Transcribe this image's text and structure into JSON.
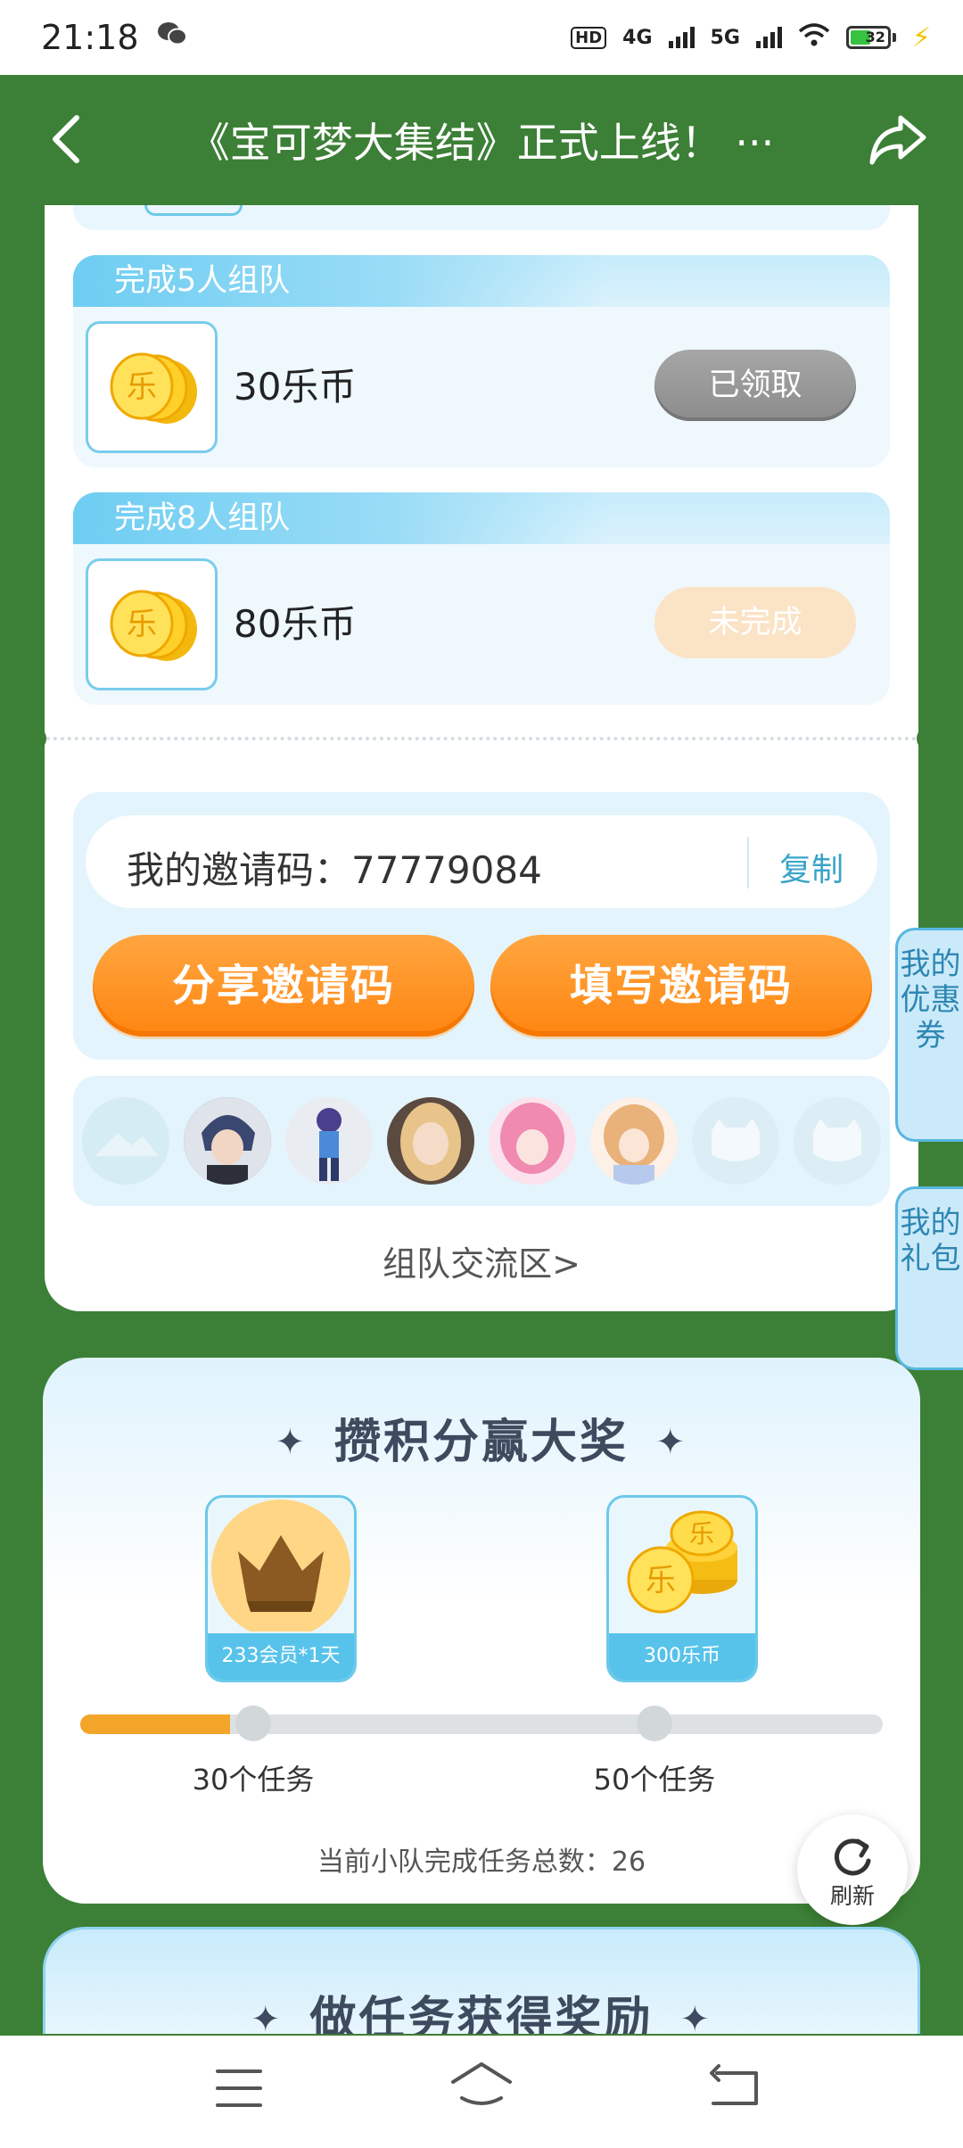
{
  "status_bar": {
    "time": "21:18",
    "network1": "4G",
    "network2": "5G",
    "battery": "32"
  },
  "header": {
    "title": "《宝可梦大集结》正式上线！ ···"
  },
  "tiers": [
    {
      "label": "完成5人组队",
      "amount": "30乐币",
      "button": "已领取"
    },
    {
      "label": "完成8人组队",
      "amount": "80乐币",
      "button": "未完成"
    }
  ],
  "invite": {
    "code_label": "我的邀请码：",
    "code": "77779084",
    "copy": "复制",
    "share_button": "分享邀请码",
    "fill_button": "填写邀请码"
  },
  "team_link": "组队交流区>",
  "side_tabs": {
    "coupons": "我的优惠券",
    "gifts": "我的礼包"
  },
  "prize_section": {
    "title": "攒积分赢大奖",
    "prizes": [
      {
        "tag": "233会员*1天",
        "milestone": "30个任务"
      },
      {
        "tag": "300乐币",
        "milestone": "50个任务"
      }
    ],
    "progress": 26,
    "summary_label": "当前小队完成任务总数：",
    "summary_value": "26"
  },
  "refresh": "刷新",
  "task_section": {
    "title": "做任务获得奖励"
  },
  "colors": {
    "accent_green": "#3c7f36",
    "orange": "#ff8510",
    "blue": "#58c3ea"
  }
}
